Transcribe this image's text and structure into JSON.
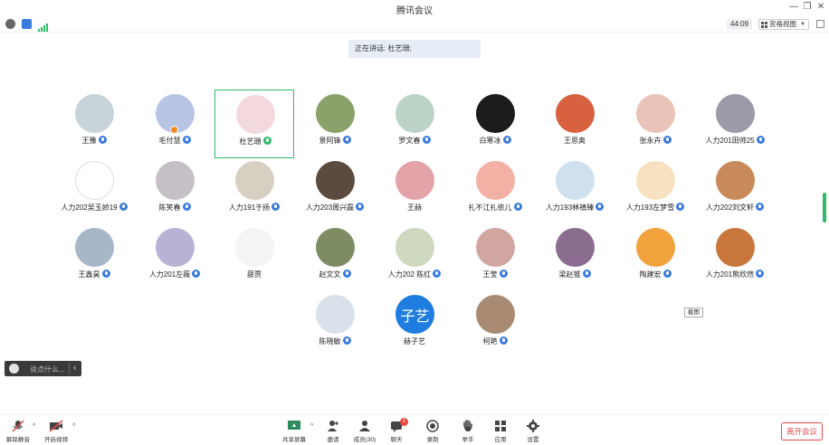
{
  "window": {
    "title": "腾讯会议"
  },
  "topbar": {
    "timer": "44:09",
    "view_label": "宫格视图"
  },
  "speaking": {
    "text": "正在讲话: 杜艺珊;"
  },
  "participants": [
    {
      "name": "王豫"
    },
    {
      "name": "毛付慧"
    },
    {
      "name": "杜艺珊"
    },
    {
      "name": "景阿锋"
    },
    {
      "name": "罗文春"
    },
    {
      "name": "白寒冰"
    },
    {
      "name": "王思奥"
    },
    {
      "name": "张永卉"
    },
    {
      "name": "人力201田帅25"
    },
    {
      "name": "人力202吴玉娇19"
    },
    {
      "name": "陈笑春"
    },
    {
      "name": "人力191于扬"
    },
    {
      "name": "人力203周兴磊"
    },
    {
      "name": "王赫"
    },
    {
      "name": "扎不江扎依儿"
    },
    {
      "name": "人力193林禛臻"
    },
    {
      "name": "人力193左梦雪"
    },
    {
      "name": "人力202刘文轩"
    },
    {
      "name": "王鑫昊"
    },
    {
      "name": "人力201左薇"
    },
    {
      "name": "薛贾"
    },
    {
      "name": "赵文文"
    },
    {
      "name": "人力202 陈红"
    },
    {
      "name": "王莹"
    },
    {
      "name": "梁赵锥"
    },
    {
      "name": "陶建宏"
    },
    {
      "name": "人力201熊欣然"
    },
    {
      "name": "陈晓敏"
    },
    {
      "name": "赫子艺",
      "avatar_text": "子艺"
    },
    {
      "name": "柯艳"
    }
  ],
  "tooltip": {
    "text": "截图"
  },
  "chat": {
    "placeholder": "说点什么..."
  },
  "toolbar": {
    "mute": "解除静音",
    "video": "开启视频",
    "share": "共享屏幕",
    "invite": "邀请",
    "members": "成员(30)",
    "chat": "聊天",
    "chat_badge": "1",
    "record": "录制",
    "raise_hand": "举手",
    "apps": "应用",
    "settings": "设置",
    "leave": "离开会议"
  },
  "colors": {
    "accent": "#3a7be0",
    "active": "#2dbb6a",
    "leave": "#e04a4a"
  }
}
